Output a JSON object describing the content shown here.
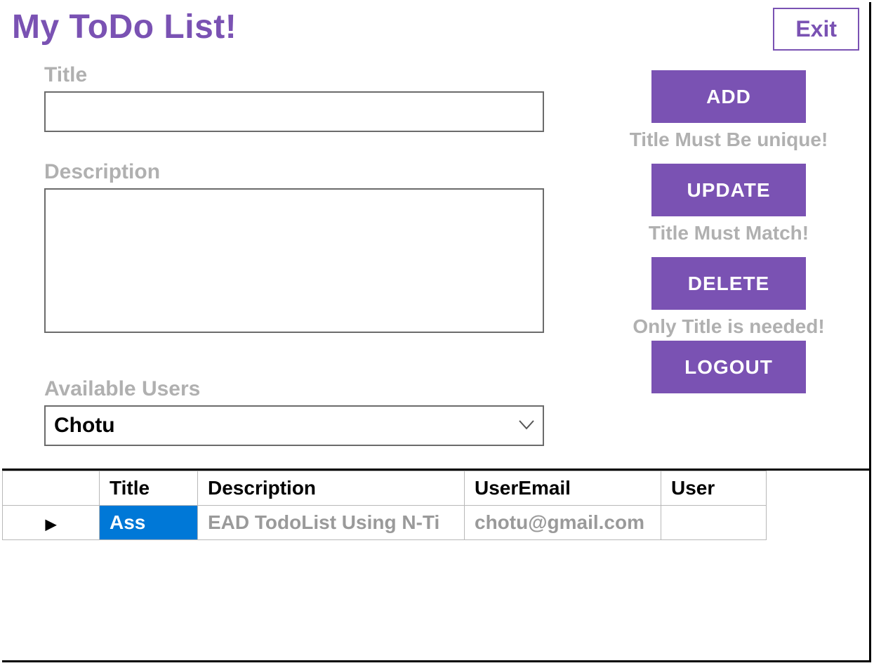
{
  "header": {
    "title": "My ToDo List!",
    "exit_label": "Exit"
  },
  "form": {
    "title_label": "Title",
    "title_value": "",
    "description_label": "Description",
    "description_value": "",
    "available_users_label": "Available Users",
    "selected_user": "Chotu"
  },
  "actions": {
    "add_label": "ADD",
    "add_hint": "Title Must Be unique!",
    "update_label": "UPDATE",
    "update_hint": "Title Must Match!",
    "delete_label": "DELETE",
    "delete_hint": "Only Title is needed!",
    "logout_label": "LOGOUT"
  },
  "grid": {
    "columns": [
      "Title",
      "Description",
      "UserEmail",
      "User"
    ],
    "rows": [
      {
        "indicator": "▶",
        "title": "Ass",
        "description": "EAD TodoList Using N-Ti",
        "useremail": "chotu@gmail.com",
        "user": ""
      }
    ]
  },
  "colors": {
    "accent": "#7a52b3",
    "muted": "#b0b0b0",
    "selected_bg": "#0078d7"
  }
}
